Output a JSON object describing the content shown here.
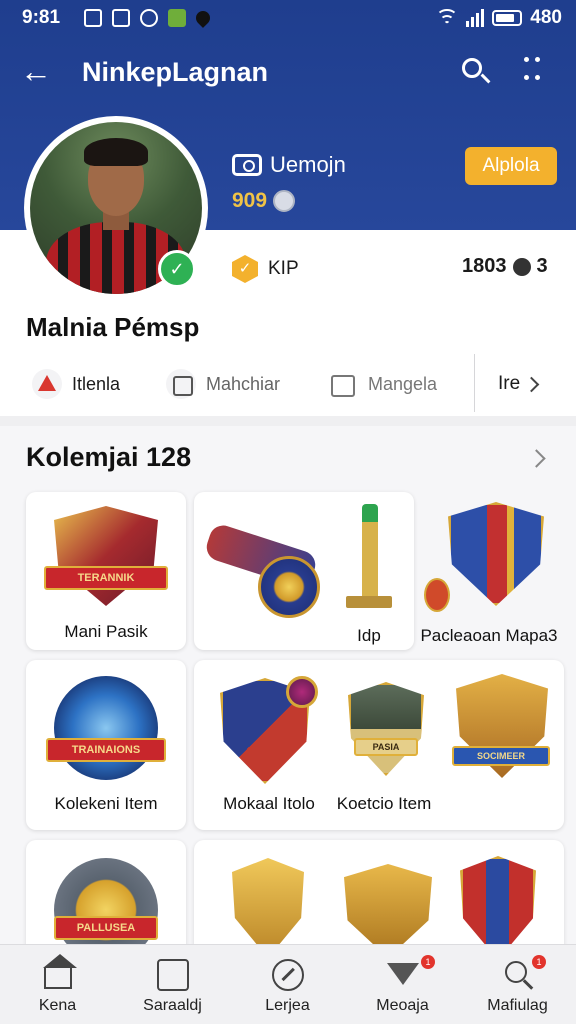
{
  "status_bar": {
    "time": "9:81",
    "battery_text": "480"
  },
  "top_bar": {
    "title": "NinkepLagnan",
    "back_icon": "arrow-left-icon",
    "search_icon": "search-icon",
    "more_icon": "more-vertical-icon"
  },
  "profile": {
    "channel_label": "Uemojn",
    "apply_button": "Alplola",
    "score": "909",
    "badge_label": "KIP",
    "badge_value": "✓",
    "followers": "1803",
    "followers_suffix": "3",
    "name": "Malnia Pémsp"
  },
  "tabs": [
    {
      "label": "Itlenla"
    },
    {
      "label": "Mahchiar"
    },
    {
      "label": "Mangela"
    },
    {
      "label": "Ire"
    }
  ],
  "collection": {
    "title": "Kolemjai 128",
    "items": [
      {
        "label": "Mani Pasik",
        "ribbon": "TERANNIK"
      },
      {
        "label": ""
      },
      {
        "label": "Idp"
      },
      {
        "label": "Pacleaoan Mapa3"
      },
      {
        "label": "Kolekeni Item",
        "ribbon": "TRAINAIONS"
      },
      {
        "label": "Mokaal Itolo"
      },
      {
        "label": "Koetcio Item",
        "ribbon": "PASIA"
      },
      {
        "label": "",
        "ribbon": "SOCIMEER"
      },
      {
        "label": "",
        "ribbon": "PALLUSEA"
      }
    ]
  },
  "bottom_nav": [
    {
      "label": "Kena",
      "icon": "home-icon"
    },
    {
      "label": "Saraaldj",
      "icon": "document-icon"
    },
    {
      "label": "Lerjea",
      "icon": "compass-icon"
    },
    {
      "label": "Meoaja",
      "icon": "funnel-icon",
      "badge": "1"
    },
    {
      "label": "Mafiulag",
      "icon": "profile-search-icon",
      "badge": "1"
    }
  ],
  "colors": {
    "header_blue": "#24449a",
    "accent_orange": "#f3b12d",
    "badge_red": "#e2342c",
    "verified_green": "#2eb154"
  }
}
